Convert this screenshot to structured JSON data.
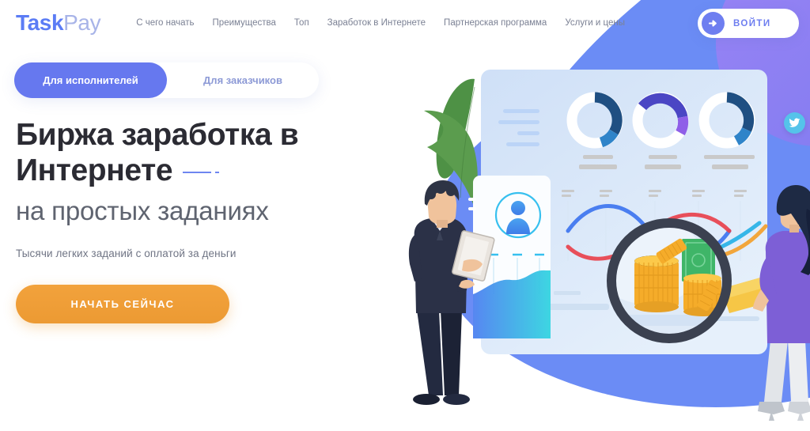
{
  "brand": {
    "part1": "Task",
    "part2": "Pay"
  },
  "nav": {
    "items": [
      {
        "label": "С чего начать"
      },
      {
        "label": "Преимущества"
      },
      {
        "label": "Топ"
      },
      {
        "label": "Заработок в Интернете"
      },
      {
        "label": "Партнерская программа"
      },
      {
        "label": "Услуги и цены"
      }
    ]
  },
  "login": {
    "label": "ВОЙТИ",
    "icon": "arrow-right-icon"
  },
  "tabs": {
    "active": "Для исполнителей",
    "inactive": "Для заказчиков"
  },
  "hero": {
    "title_line1": "Биржа заработка в",
    "title_line2": "Интернете",
    "subtitle": "на простых заданиях",
    "tagline": "Тысячи легких заданий с оплатой за деньги",
    "cta": "НАЧАТЬ СЕЙЧАС"
  },
  "social": {
    "twitter": "twitter-icon"
  },
  "colors": {
    "brand_blue": "#5b7cf5",
    "brand_blue_light": "#a8b4e8",
    "tab_active_bg": "#6678ef",
    "tab_inactive_text": "#8d9ad6",
    "cta_orange": "#ec9a33",
    "heading": "#2b2b33",
    "subheading": "#5f6470",
    "nav_text": "#7b8194",
    "bg_blue": "#6b8cf5",
    "bg_purple": "#8b7df0",
    "twitter_blue": "#55c3ea",
    "leaf_green": "#4e9145",
    "suit_navy": "#2b3147",
    "blouse_purple": "#7d5fd6",
    "coin_gold": "#f5ac2a",
    "banknote_green": "#3fb568"
  },
  "illustration": {
    "elements": [
      "dashboard-card",
      "donut-chart-1",
      "donut-chart-2",
      "donut-chart-3",
      "profile-card",
      "area-chart",
      "wave-line-chart",
      "magnifier",
      "coin-stacks",
      "banknote",
      "man-with-tablet",
      "woman-with-magnifier",
      "green-leaf"
    ],
    "donuts": [
      {
        "name": "donut-chart-1",
        "segments": [
          {
            "color": "#1f4f82",
            "pct": 22
          },
          {
            "color": "#2f84c9",
            "pct": 12
          }
        ]
      },
      {
        "name": "donut-chart-2",
        "segments": [
          {
            "color": "#4b46c4",
            "pct": 24
          },
          {
            "color": "#8f5fe8",
            "pct": 10
          }
        ]
      },
      {
        "name": "donut-chart-3",
        "segments": [
          {
            "color": "#1f4f82",
            "pct": 20
          },
          {
            "color": "#2f84c9",
            "pct": 10
          }
        ]
      }
    ],
    "wave_lines": [
      "#4a7ef0",
      "#e8414c",
      "#36b6e8",
      "#f2a63c"
    ]
  }
}
